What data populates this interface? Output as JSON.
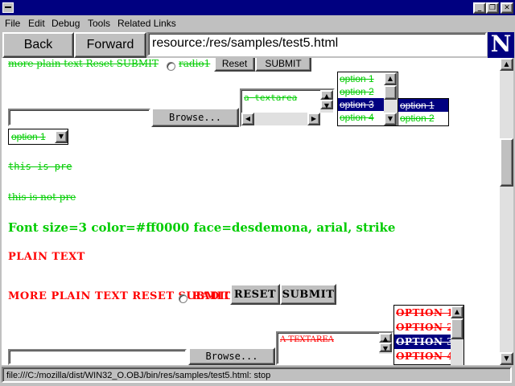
{
  "window": {
    "minimize_glyph": "_",
    "restore_glyph": "❐",
    "close_glyph": "✕"
  },
  "menubar": {
    "items": [
      {
        "label": "File"
      },
      {
        "label": "Edit"
      },
      {
        "label": "Debug"
      },
      {
        "label": "Tools"
      },
      {
        "label": "Related Links"
      }
    ]
  },
  "navbar": {
    "back_label": "Back",
    "forward_label": "Forward",
    "url": "resource:/res/samples/test5.html",
    "logo_letter": "N"
  },
  "green_section": {
    "line1_text": "more plain text Reset SUBMIT",
    "radio_label": "radio1",
    "reset_label": "Reset",
    "submit_label": "SUBMIT",
    "file_value": "",
    "browse_label": "Browse...",
    "textarea_value": "a textarea",
    "listbox_options": [
      "option 1",
      "option 2",
      "option 3",
      "option 4"
    ],
    "listbox_selected_index": 2,
    "listbox2_options": [
      "option 1",
      "option 2"
    ],
    "listbox2_selected_index": 0,
    "select_value": "option 1",
    "pre_text": "this is pre",
    "not_pre_text": "this is not pre",
    "font_text": "Font size=3 color=#ff0000 face=desdemona, arial, strike"
  },
  "red_section": {
    "plain_text": "PLAIN TEXT",
    "line_text": "MORE PLAIN TEXT RESET SUBMIT",
    "radio_label": "RADIO1",
    "reset_label": "RESET",
    "submit_label": "SUBMIT",
    "file_value": "",
    "browse_label": "Browse...",
    "textarea_value": "A TEXTAREA",
    "listbox_options": [
      "OPTION 1",
      "OPTION 2",
      "OPTION 3",
      "OPTION 4"
    ],
    "listbox_selected_index": 2
  },
  "status": {
    "text": "file:///C:/mozilla/dist/WIN32_O.OBJ/bin/res/samples/test5.html: stop"
  },
  "colors": {
    "title_bar": "#000080",
    "green_text": "#00cc00",
    "red_text": "#ff0000",
    "selection": "#000080"
  }
}
